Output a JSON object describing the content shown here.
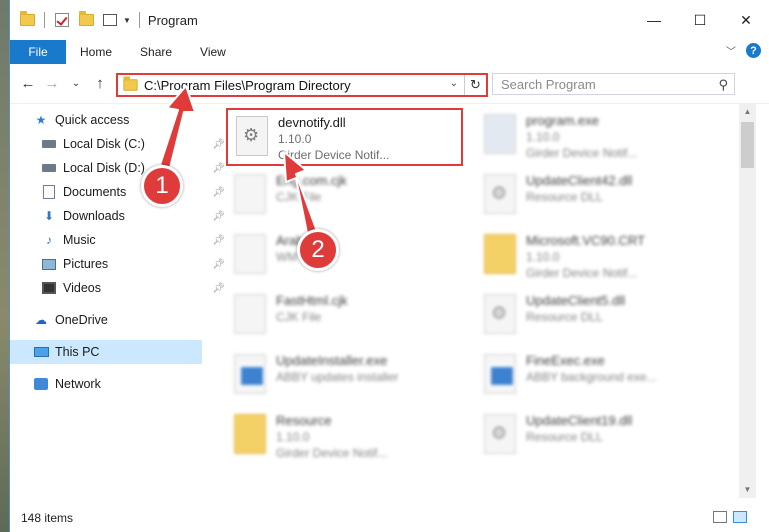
{
  "window": {
    "title": "Program",
    "controls": {
      "minimize": "—",
      "maximize": "☐",
      "close": "✕"
    }
  },
  "ribbon": {
    "file": "File",
    "tabs": [
      "Home",
      "Share",
      "View"
    ],
    "help": "?"
  },
  "nav": {
    "back": "←",
    "forward": "→",
    "recent": "⌄",
    "up": "↑",
    "address": "C:\\Program Files\\Program Directory",
    "refresh": "↻",
    "search_placeholder": "Search Program",
    "search_icon": "⚲"
  },
  "sidebar": {
    "items": [
      {
        "label": "Quick access",
        "icon": "star-icon",
        "pinned": false
      },
      {
        "label": "Local Disk (C:)",
        "icon": "disk-icon",
        "pinned": true
      },
      {
        "label": "Local Disk (D:)",
        "icon": "disk-icon",
        "pinned": true
      },
      {
        "label": "Documents",
        "icon": "documents-icon",
        "pinned": true
      },
      {
        "label": "Downloads",
        "icon": "downloads-icon",
        "pinned": true
      },
      {
        "label": "Music",
        "icon": "music-icon",
        "pinned": true
      },
      {
        "label": "Pictures",
        "icon": "pictures-icon",
        "pinned": true
      },
      {
        "label": "Videos",
        "icon": "videos-icon",
        "pinned": true
      },
      {
        "label": "OneDrive",
        "icon": "cloud-icon",
        "pinned": false
      },
      {
        "label": "This PC",
        "icon": "computer-icon",
        "pinned": false,
        "selected": true
      },
      {
        "label": "Network",
        "icon": "network-icon",
        "pinned": false
      }
    ]
  },
  "files": [
    {
      "name": "devnotify.dll",
      "line2": "1.10.0",
      "line3": "Girder Device Notif...",
      "highlighted": true
    },
    {
      "name": "program.exe",
      "line2": "1.10.0",
      "line3": "Girder Device Notif..."
    },
    {
      "name": "Eng.com.cjk",
      "line2": "CJK File",
      "line3": ""
    },
    {
      "name": "UpdateClient42.dll",
      "line2": "Resource DLL",
      "line3": ""
    },
    {
      "name": "Arabic.cjk",
      "line2": "WM File",
      "line3": ""
    },
    {
      "name": "Microsoft.VC90.CRT",
      "line2": "1.10.0",
      "line3": "Girder Device Notif..."
    },
    {
      "name": "FastHtml.cjk",
      "line2": "CJK File",
      "line3": ""
    },
    {
      "name": "UpdateClient5.dll",
      "line2": "Resource DLL",
      "line3": ""
    },
    {
      "name": "UpdateInstaller.exe",
      "line2": "ABBY updates installer",
      "line3": ""
    },
    {
      "name": "FineExec.exe",
      "line2": "ABBY background exe...",
      "line3": ""
    },
    {
      "name": "Resource",
      "line2": "1.10.0",
      "line3": "Girder Device Notif..."
    },
    {
      "name": "UpdateClient19.dll",
      "line2": "Resource DLL",
      "line3": ""
    }
  ],
  "annotations": {
    "step1": "1",
    "step2": "2"
  },
  "status": {
    "items_count": "148 items"
  },
  "colors": {
    "accent": "#1979ca",
    "highlight": "#e03b3b",
    "selected": "#cce8ff"
  }
}
